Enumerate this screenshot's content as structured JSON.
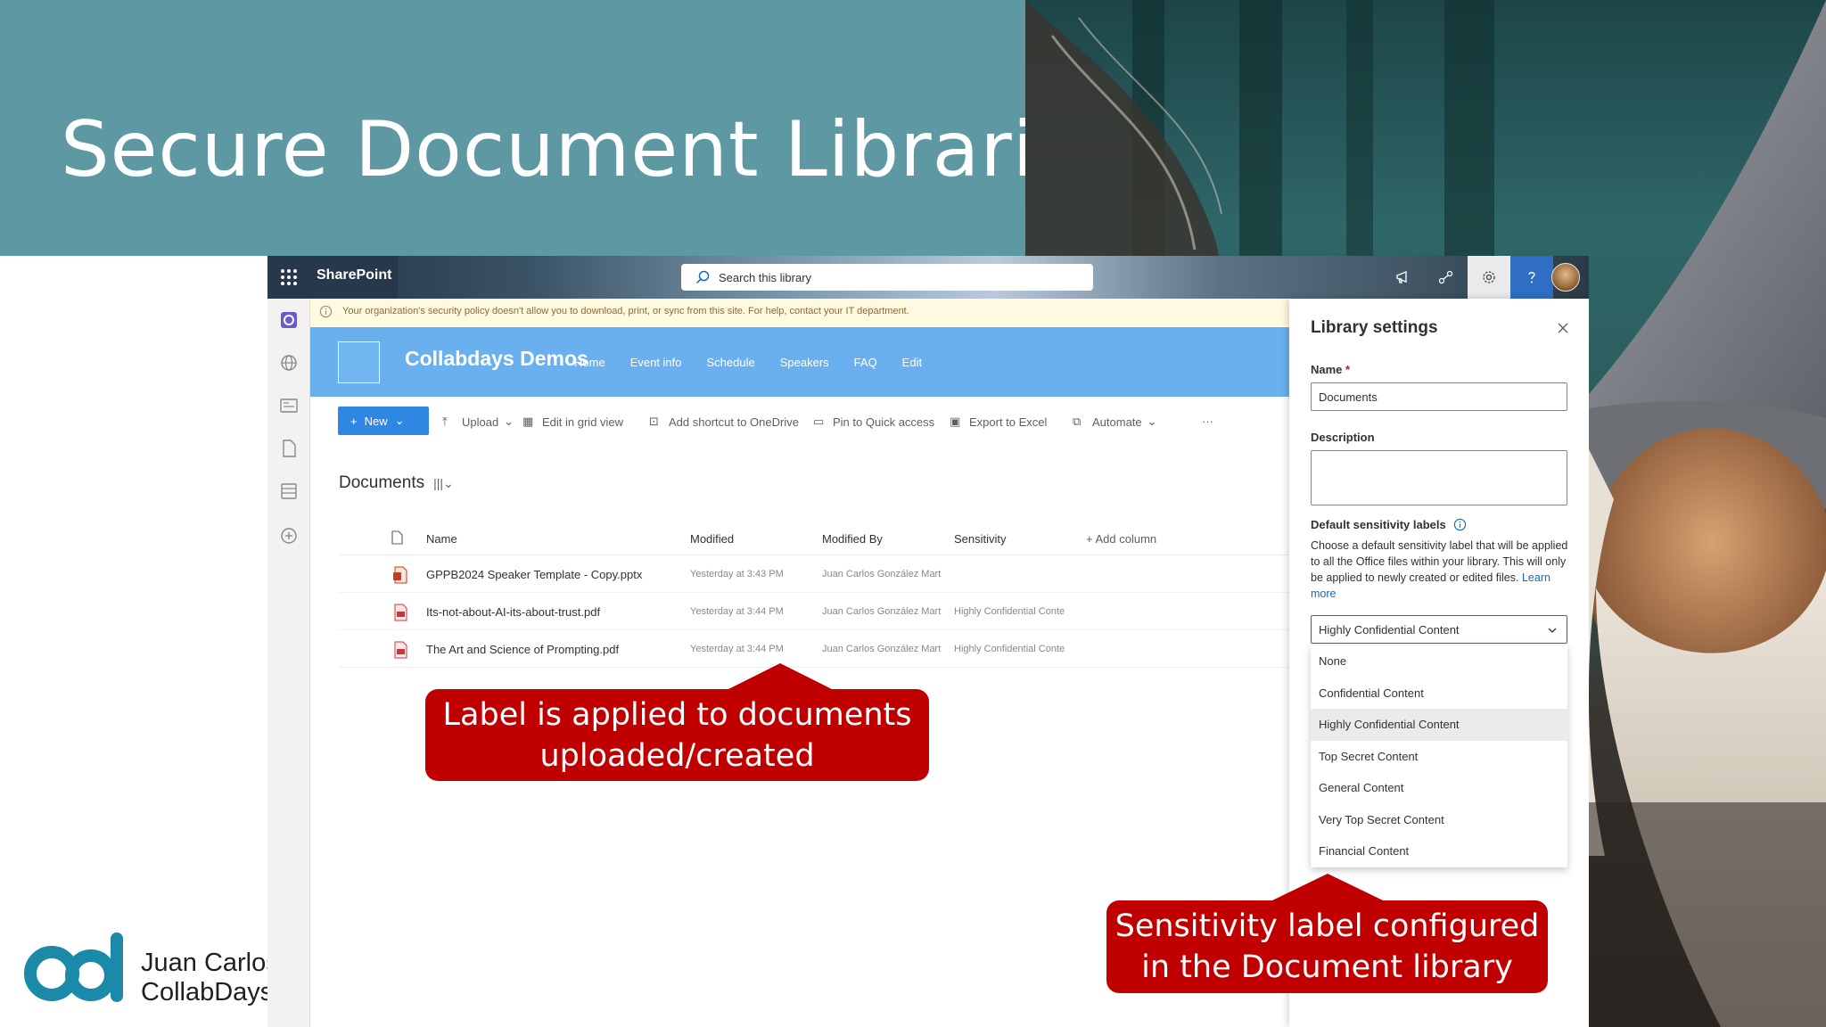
{
  "slide": {
    "title": "Secure Document Libraries",
    "presenter_line1": "Juan Carlos",
    "presenter_line2": "CollabDays"
  },
  "suite": {
    "app_name": "SharePoint",
    "search_placeholder": "Search this library"
  },
  "notice": "Your organization's security policy doesn't allow you to download, print, or sync from this site. For help, contact your IT department.",
  "site": {
    "title": "Collabdays Demos",
    "nav": [
      "Home",
      "Event info",
      "Schedule",
      "Speakers",
      "FAQ",
      "Edit"
    ]
  },
  "commands": {
    "new": "New",
    "upload": "Upload",
    "grid": "Edit in grid view",
    "shortcut": "Add shortcut to OneDrive",
    "pin": "Pin to Quick access",
    "excel": "Export to Excel",
    "automate": "Automate",
    "more": "···"
  },
  "library": {
    "heading": "Documents",
    "columns": {
      "name": "Name",
      "modified": "Modified",
      "modified_by": "Modified By",
      "sensitivity": "Sensitivity",
      "add_column": "+ Add column"
    },
    "rows": [
      {
        "name": "GPPB2024 Speaker Template - Copy.pptx",
        "modified": "Yesterday at 3:43 PM",
        "modified_by": "Juan Carlos González Mart",
        "sensitivity": "",
        "type": "pptx"
      },
      {
        "name": "Its-not-about-AI-its-about-trust.pdf",
        "modified": "Yesterday at 3:44 PM",
        "modified_by": "Juan Carlos González Mart",
        "sensitivity": "Highly Confidential Conte",
        "type": "pdf"
      },
      {
        "name": "The Art and Science of Prompting.pdf",
        "modified": "Yesterday at 3:44 PM",
        "modified_by": "Juan Carlos González Mart",
        "sensitivity": "Highly Confidential Conte",
        "type": "pdf"
      }
    ]
  },
  "callouts": {
    "left_line1": "Label is applied to documents",
    "left_line2": "uploaded/created",
    "right_line1": "Sensitivity label configured",
    "right_line2": "in the Document library"
  },
  "panel": {
    "title": "Library settings",
    "name_label": "Name",
    "required_mark": "*",
    "name_value": "Documents",
    "description_label": "Description",
    "description_value": "",
    "sensitivity_label": "Default sensitivity labels",
    "help_text": "Choose a default sensitivity label that will be applied to all the Office files within your library. This will only be applied to newly created or edited files.",
    "learn_more": "Learn more",
    "selected": "Highly Confidential Content",
    "options": [
      "None",
      "Confidential Content",
      "Highly Confidential Content",
      "Top Secret Content",
      "General Content",
      "Very Top Secret Content",
      "Financial Content"
    ]
  },
  "colors": {
    "title_band": "#5d98a3",
    "site_header": "#6ab0ef",
    "primary_button": "#2f87e4",
    "callout": "#c00000"
  }
}
